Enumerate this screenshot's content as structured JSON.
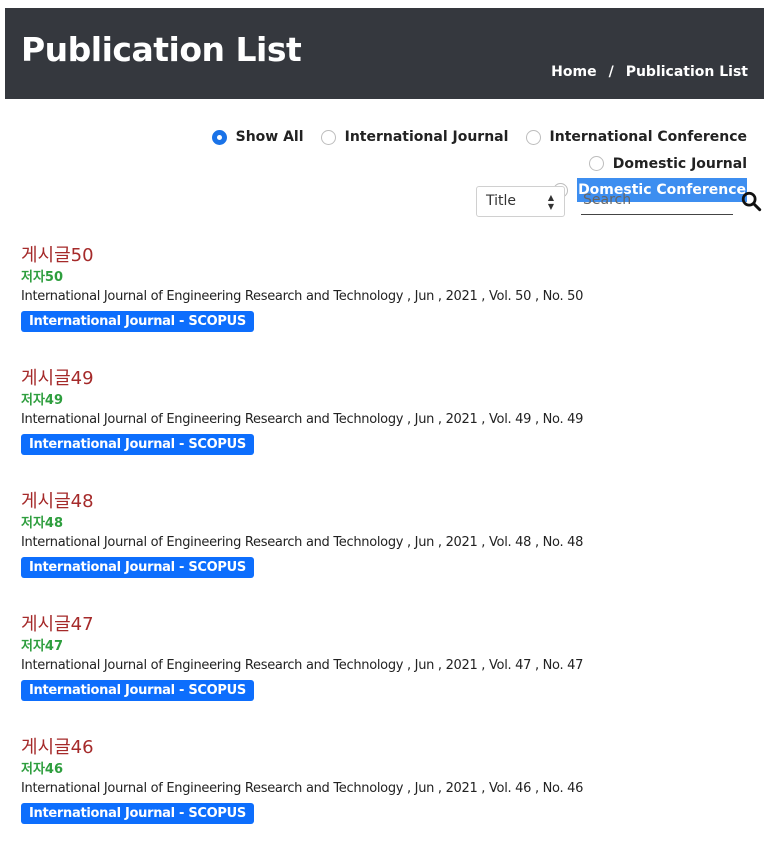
{
  "header": {
    "title": "Publication List",
    "breadcrumb": [
      "Home",
      "/",
      "Publication List"
    ]
  },
  "filters": [
    {
      "label": "Show All",
      "checked": true
    },
    {
      "label": "International Journal",
      "checked": false
    },
    {
      "label": "International Conference",
      "checked": false
    },
    {
      "label": "Domestic Journal",
      "checked": false
    },
    {
      "label": "Domestic Conference",
      "checked": false,
      "highlighted": true
    }
  ],
  "search": {
    "field_selected": "Title",
    "placeholder": "Search",
    "value": ""
  },
  "publications": [
    {
      "title": "게시글50",
      "author": "저자50",
      "info": "International Journal of Engineering Research and Technology , Jun , 2021 , Vol. 50 , No. 50",
      "badge": "International Journal - SCOPUS"
    },
    {
      "title": "게시글49",
      "author": "저자49",
      "info": "International Journal of Engineering Research and Technology , Jun , 2021 , Vol. 49 , No. 49",
      "badge": "International Journal - SCOPUS"
    },
    {
      "title": "게시글48",
      "author": "저자48",
      "info": "International Journal of Engineering Research and Technology , Jun , 2021 , Vol. 48 , No. 48",
      "badge": "International Journal - SCOPUS"
    },
    {
      "title": "게시글47",
      "author": "저자47",
      "info": "International Journal of Engineering Research and Technology , Jun , 2021 , Vol. 47 , No. 47",
      "badge": "International Journal - SCOPUS"
    },
    {
      "title": "게시글46",
      "author": "저자46",
      "info": "International Journal of Engineering Research and Technology , Jun , 2021 , Vol. 46 , No. 46",
      "badge": "International Journal - SCOPUS"
    }
  ],
  "colors": {
    "header_bg": "#35383e",
    "title_red": "#a52a2a",
    "author_green": "#2e9e3e",
    "badge_blue": "#0d6efd",
    "radio_blue": "#1a73e8"
  }
}
